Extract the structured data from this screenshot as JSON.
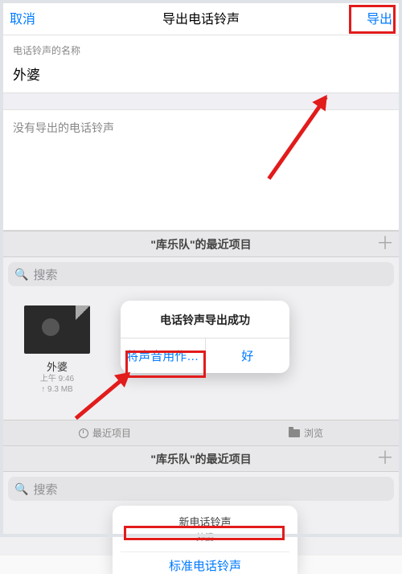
{
  "nav": {
    "cancel": "取消",
    "title": "导出电话铃声",
    "export": "导出"
  },
  "form": {
    "nameLabel": "电话铃声的名称",
    "nameValue": "外婆"
  },
  "noExport": "没有导出的电话铃声",
  "panel1": {
    "title": "\"库乐队\"的最近项目",
    "searchPlaceholder": "搜索",
    "thumbName": "外婆",
    "thumbTime": "上午 9:46",
    "thumbSize": "↑ 9.3 MB",
    "popupTitle": "电话铃声导出成功",
    "popupUse": "将声音用作…",
    "popupOk": "好",
    "tabRecent": "最近项目",
    "tabBrowse": "浏览"
  },
  "panel2": {
    "title": "\"库乐队\"的最近项目",
    "searchPlaceholder": "搜索",
    "sheetTitle": "新电话铃声",
    "sheetSub": "\"外婆\"",
    "sheetAction": "标准电话铃声"
  }
}
